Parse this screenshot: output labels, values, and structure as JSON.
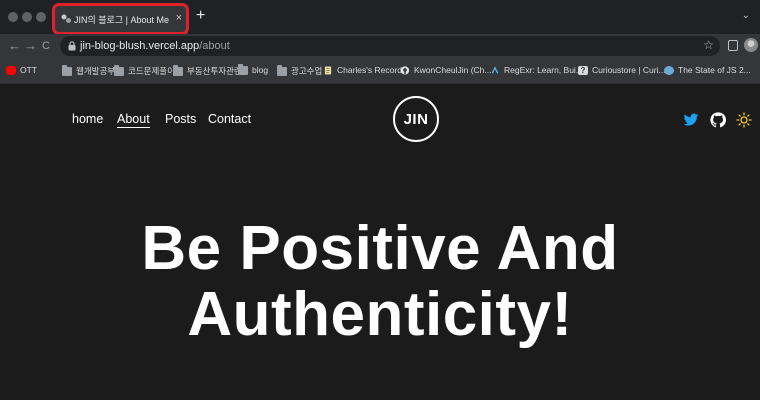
{
  "browser": {
    "tab": {
      "title": "JIN의 블로그 | About Me",
      "close": "×"
    },
    "new_tab": "+",
    "nav": {
      "back": "←",
      "forward": "→",
      "reload": "C"
    },
    "url": {
      "host": "jin-blog-blush.vercel.app",
      "path": "/about"
    },
    "star": "☆",
    "strip_chevron": "⌄",
    "bookmarks": [
      {
        "label": "OTT",
        "icon": "youtube-icon"
      },
      {
        "label": "웹개발공부",
        "icon": "folder-icon"
      },
      {
        "label": "코드문제풀이",
        "icon": "folder-icon"
      },
      {
        "label": "부동산투자관련",
        "icon": "folder-icon"
      },
      {
        "label": "blog",
        "icon": "folder-icon"
      },
      {
        "label": "광고수업",
        "icon": "folder-icon"
      },
      {
        "label": "Charles's Record",
        "icon": "page-icon"
      },
      {
        "label": "KwonCheulJin (Ch...",
        "icon": "github-icon"
      },
      {
        "label": "RegExr: Learn, Bui...",
        "icon": "regexr-icon"
      },
      {
        "label": "Curioustore | Curi...",
        "icon": "question-icon"
      },
      {
        "label": "The State of JS 2...",
        "icon": "js-icon"
      }
    ]
  },
  "site": {
    "nav": [
      {
        "label": "home",
        "active": false
      },
      {
        "label": "About",
        "active": true
      },
      {
        "label": "Posts",
        "active": false
      },
      {
        "label": "Contact",
        "active": false
      }
    ],
    "logo": "JIN",
    "social": [
      "twitter-icon",
      "github-icon",
      "sun-icon"
    ],
    "hero": {
      "line1": "Be Positive And",
      "line2": "Authenticity!"
    }
  },
  "colors": {
    "page_bg": "#1b1b1b",
    "tab_highlight": "#e0202a",
    "twitter": "#1da1f2",
    "sun": "#f4c430"
  }
}
